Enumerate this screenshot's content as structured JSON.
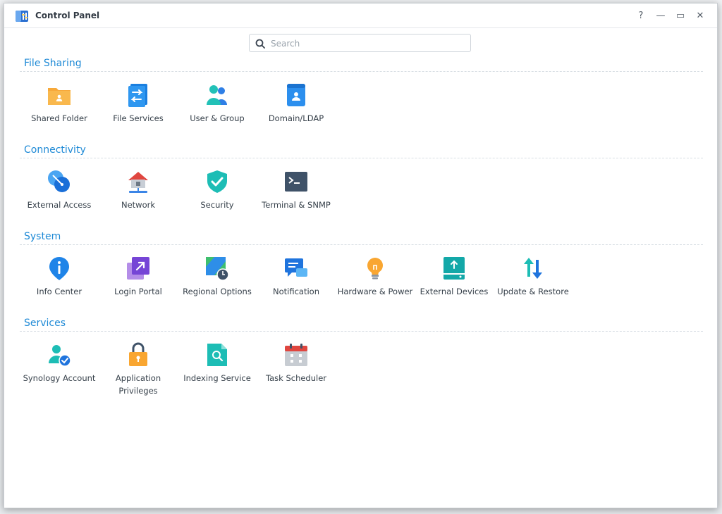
{
  "window": {
    "title": "Control Panel"
  },
  "search": {
    "placeholder": "Search",
    "value": ""
  },
  "controls": {
    "help": "?",
    "minimize": "—",
    "maximize": "▭",
    "close": "✕"
  },
  "sections": [
    {
      "title": "File Sharing",
      "items": [
        {
          "label": "Shared Folder",
          "icon": "shared-folder-icon"
        },
        {
          "label": "File Services",
          "icon": "file-services-icon"
        },
        {
          "label": "User & Group",
          "icon": "user-group-icon"
        },
        {
          "label": "Domain/LDAP",
          "icon": "domain-ldap-icon"
        }
      ]
    },
    {
      "title": "Connectivity",
      "items": [
        {
          "label": "External Access",
          "icon": "external-access-icon"
        },
        {
          "label": "Network",
          "icon": "network-icon"
        },
        {
          "label": "Security",
          "icon": "security-shield-icon"
        },
        {
          "label": "Terminal & SNMP",
          "icon": "terminal-icon"
        }
      ]
    },
    {
      "title": "System",
      "items": [
        {
          "label": "Info Center",
          "icon": "info-center-icon"
        },
        {
          "label": "Login Portal",
          "icon": "login-portal-icon"
        },
        {
          "label": "Regional Options",
          "icon": "regional-options-icon"
        },
        {
          "label": "Notification",
          "icon": "notification-icon"
        },
        {
          "label": "Hardware & Power",
          "icon": "hardware-power-icon"
        },
        {
          "label": "External Devices",
          "icon": "external-devices-icon"
        },
        {
          "label": "Update & Restore",
          "icon": "update-restore-icon"
        }
      ]
    },
    {
      "title": "Services",
      "items": [
        {
          "label": "Synology Account",
          "icon": "synology-account-icon"
        },
        {
          "label": "Application Privileges",
          "icon": "application-privileges-icon"
        },
        {
          "label": "Indexing Service",
          "icon": "indexing-service-icon"
        },
        {
          "label": "Task Scheduler",
          "icon": "task-scheduler-icon"
        }
      ]
    }
  ]
}
